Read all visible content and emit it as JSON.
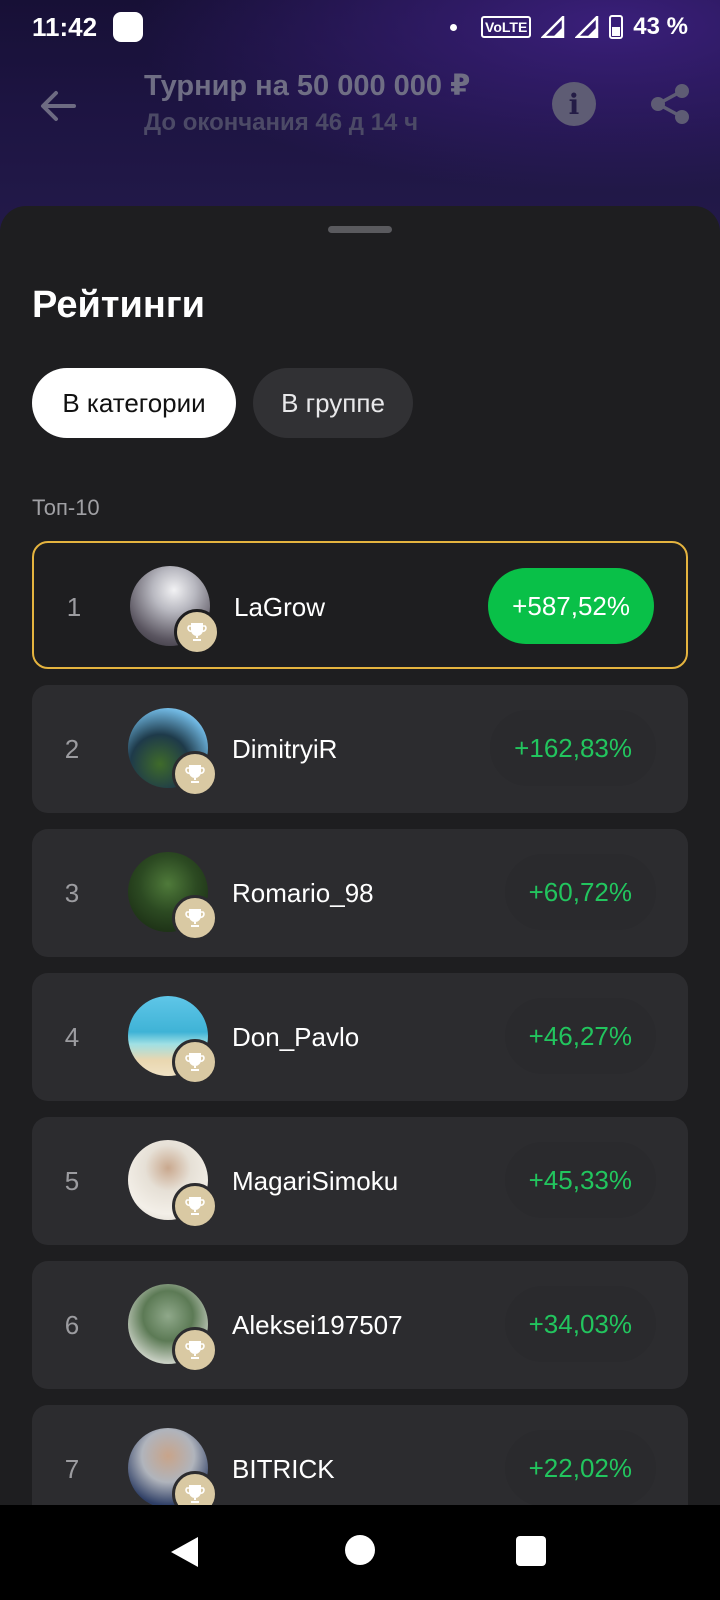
{
  "status_bar": {
    "time": "11:42",
    "volte": "VoLTE",
    "battery": "43 %"
  },
  "header": {
    "title": "Турнир на 50 000 000 ₽",
    "subtitle": "До окончания 46 д 14 ч",
    "icons": [
      "back-arrow-icon",
      "info-icon",
      "share-icon"
    ]
  },
  "sheet": {
    "title": "Рейтинги",
    "tabs": [
      {
        "label": "В категории",
        "active": true
      },
      {
        "label": "В группе",
        "active": false
      }
    ],
    "section_label": "Топ-10",
    "leaderboard": [
      {
        "rank": "1",
        "username": "LaGrow",
        "score": "+587,52%"
      },
      {
        "rank": "2",
        "username": "DimitryiR",
        "score": "+162,83%"
      },
      {
        "rank": "3",
        "username": "Romario_98",
        "score": "+60,72%"
      },
      {
        "rank": "4",
        "username": "Don_Pavlo",
        "score": "+46,27%"
      },
      {
        "rank": "5",
        "username": "MagariSimoku",
        "score": "+45,33%"
      },
      {
        "rank": "6",
        "username": "Aleksei197507",
        "score": "+34,03%"
      },
      {
        "rank": "7",
        "username": "BITRICK",
        "score": "+22,02%"
      }
    ]
  },
  "colors": {
    "accent_green": "#09c048",
    "score_green_text": "#22c55e",
    "highlight_border": "#e5b43f",
    "sheet_bg": "#1e1e20",
    "row_bg": "#2c2c2f"
  }
}
